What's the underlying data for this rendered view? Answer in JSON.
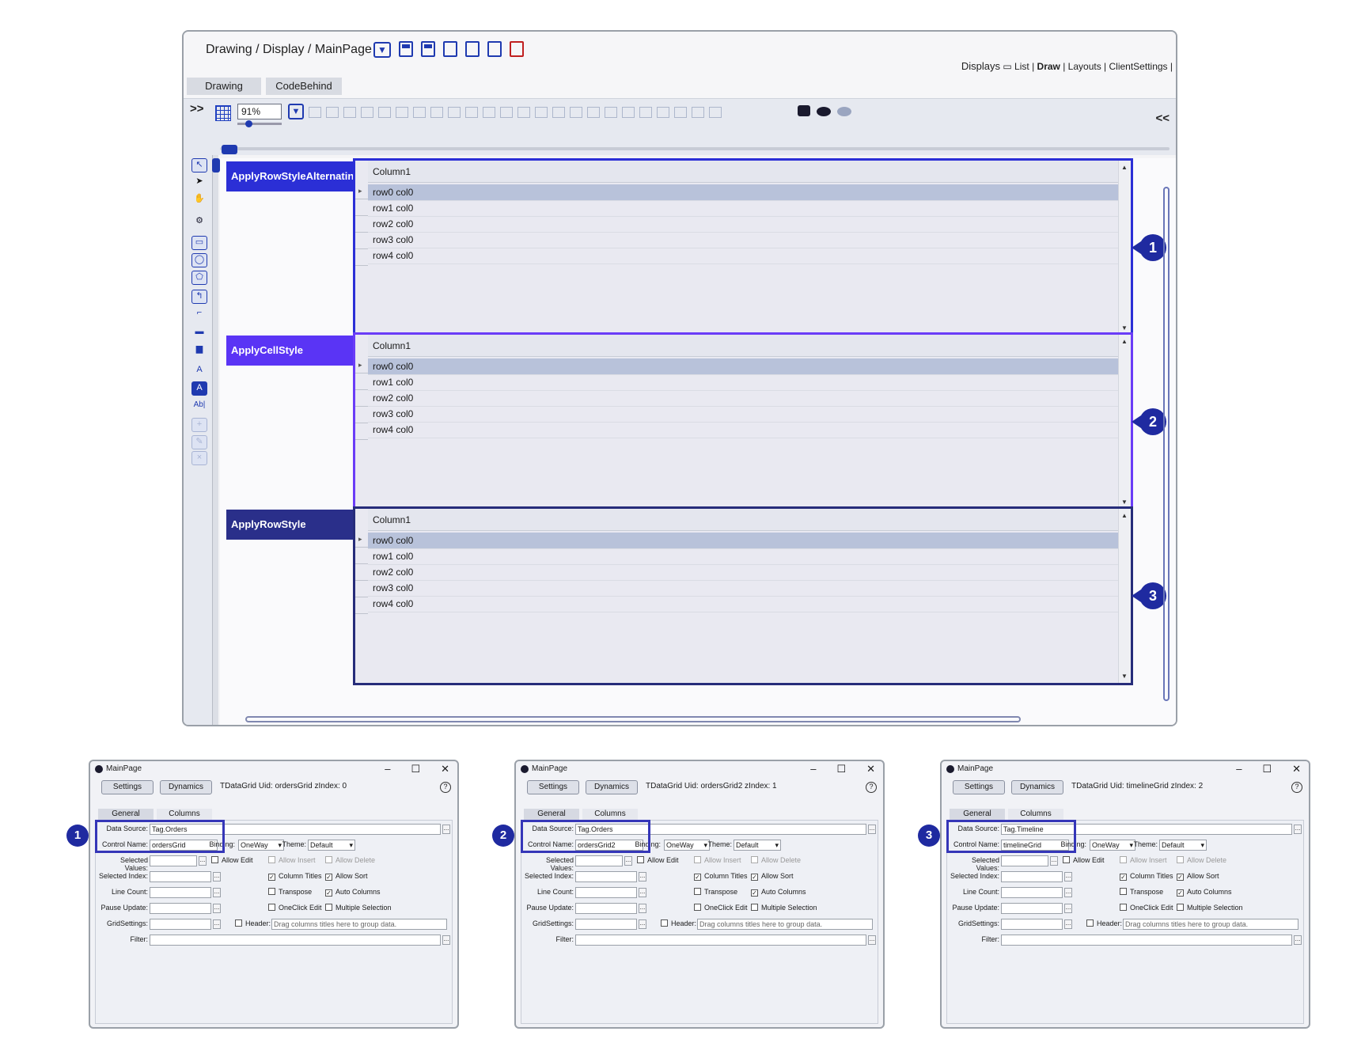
{
  "editor": {
    "breadcrumb": "Drawing / Display / MainPage",
    "displays_label": "Displays",
    "displays_links": [
      "List",
      "Draw",
      "Layouts",
      "ClientSettings"
    ],
    "tabs": [
      "Drawing",
      "CodeBehind"
    ],
    "zoom": "91%",
    "toolbar_prev": ">>",
    "toolbar_next": "<<",
    "rows": [
      {
        "button": "ApplyRowStyleAlternating",
        "button_color": "#2b2fd6",
        "grid_border": "#2b2fd6",
        "callout": "1"
      },
      {
        "button": "ApplyCellStyle",
        "button_color": "#5a34f5",
        "grid_border": "#6a3cf7",
        "callout": "2"
      },
      {
        "button": "ApplyRowStyle",
        "button_color": "#2a2f8a",
        "grid_border": "#262c7a",
        "callout": "3"
      }
    ],
    "grid": {
      "column_header": "Column1",
      "rows": [
        "row0 col0",
        "row1 col0",
        "row2 col0",
        "row3 col0",
        "row4 col0"
      ]
    }
  },
  "dialogs": [
    {
      "title": "MainPage",
      "settings": "Settings",
      "dynamics": "Dynamics",
      "uid": "TDataGrid Uid: ordersGrid zIndex: 0",
      "tab_general": "General",
      "tab_columns": "Columns",
      "data_source": "Tag.Orders",
      "control_name": "ordersGrid",
      "callout": "1"
    },
    {
      "title": "MainPage",
      "settings": "Settings",
      "dynamics": "Dynamics",
      "uid": "TDataGrid Uid: ordersGrid2 zIndex: 1",
      "tab_general": "General",
      "tab_columns": "Columns",
      "data_source": "Tag.Orders",
      "control_name": "ordersGrid2",
      "callout": "2"
    },
    {
      "title": "MainPage",
      "settings": "Settings",
      "dynamics": "Dynamics",
      "uid": "TDataGrid Uid: timelineGrid zIndex: 2",
      "tab_general": "General",
      "tab_columns": "Columns",
      "data_source": "Tag.Timeline",
      "control_name": "timelineGrid",
      "callout": "3"
    }
  ],
  "dialog_labels": {
    "data_source": "Data Source:",
    "control_name": "Control Name:",
    "binding": "Binding:",
    "binding_value": "OneWay",
    "theme": "Theme:",
    "theme_value": "Default",
    "selected_values": "Selected Values:",
    "selected_index": "Selected Index:",
    "line_count": "Line Count:",
    "pause_update": "Pause Update:",
    "grid_settings": "GridSettings:",
    "filter": "Filter:",
    "allow_edit": "Allow Edit",
    "allow_insert": "Allow Insert",
    "allow_delete": "Allow Delete",
    "column_titles": "Column Titles",
    "allow_sort": "Allow Sort",
    "transpose": "Transpose",
    "auto_columns": "Auto Columns",
    "oneclick_edit": "OneClick Edit",
    "multiple_selection": "Multiple Selection",
    "header": "Header:",
    "header_placeholder": "Drag columns titles here to group data."
  }
}
